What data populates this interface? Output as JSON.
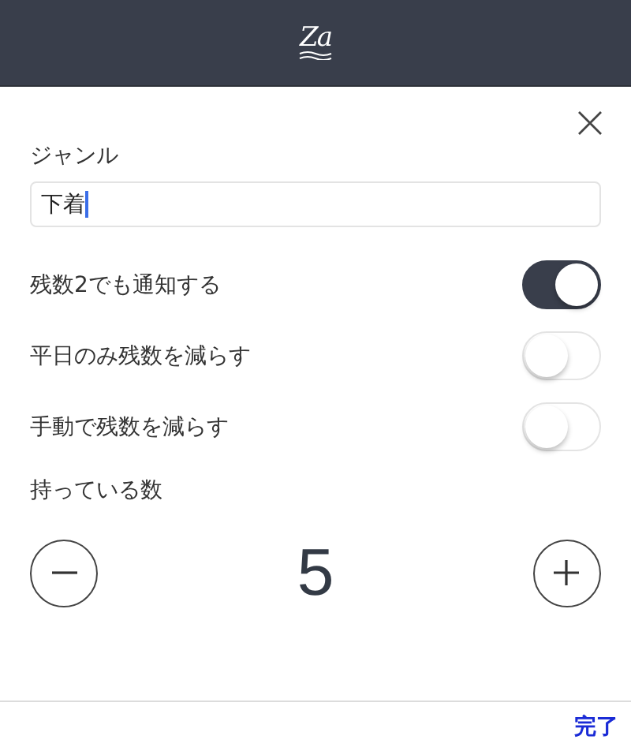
{
  "header": {
    "logo": "Za"
  },
  "genre": {
    "label": "ジャンル",
    "value": "下着",
    "focused": true
  },
  "settings": [
    {
      "label": "残数2でも通知する",
      "on": true
    },
    {
      "label": "平日のみ残数を減らす",
      "on": false
    },
    {
      "label": "手動で残数を減らす",
      "on": false
    }
  ],
  "count": {
    "label": "持っている数",
    "value": "5"
  },
  "footer": {
    "done": "完了"
  }
}
